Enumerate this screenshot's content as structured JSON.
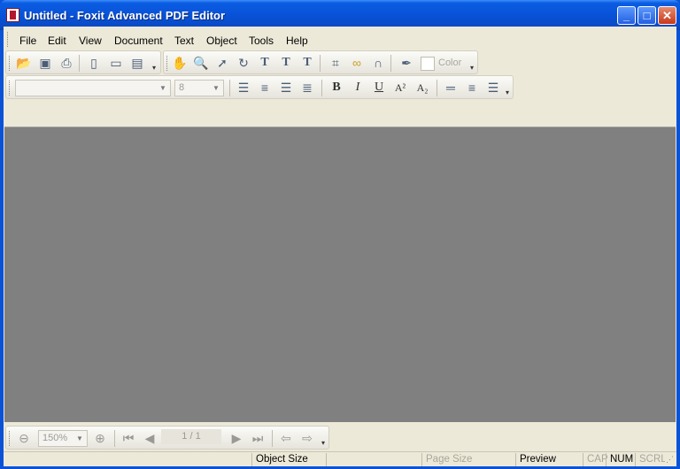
{
  "window": {
    "title": "Untitled - Foxit Advanced PDF Editor",
    "controls": {
      "minimize": "_",
      "maximize": "□",
      "close": "✕"
    }
  },
  "menu": [
    "File",
    "Edit",
    "View",
    "Document",
    "Text",
    "Object",
    "Tools",
    "Help"
  ],
  "toolbar1": {
    "icons": [
      "open-icon",
      "save-icon",
      "print-icon",
      "new-document-icon",
      "page-setup-icon",
      "page-properties-icon",
      "hand-tool-icon",
      "zoom-tool-icon",
      "select-arrow-icon",
      "rotate-icon",
      "text-tool-icon",
      "add-text-icon",
      "text-numbering-icon",
      "crop-icon",
      "link-icon",
      "path-tool-icon",
      "eyedropper-icon"
    ],
    "color_label": "Color"
  },
  "toolbar2": {
    "font_name": "",
    "font_size": "8",
    "buttons": [
      "align-left-icon",
      "align-center-icon",
      "align-right-icon",
      "justify-icon",
      "bold-icon",
      "italic-icon",
      "underline-icon",
      "superscript-icon",
      "subscript-icon",
      "line-spacing-1-icon",
      "line-spacing-2-icon",
      "line-spacing-3-icon"
    ],
    "bold": "B",
    "italic": "I",
    "underline": "U",
    "superscript": "A²",
    "subscript": "A₂"
  },
  "navbar": {
    "zoom_value": "150%",
    "page_indicator": "1 / 1"
  },
  "status": {
    "object_size": "Object Size",
    "page_size": "Page Size",
    "preview": "Preview",
    "cap": "CAP",
    "num": "NUM",
    "scrl": "SCRL"
  },
  "colors": {
    "title_bar": "#0A53D8",
    "document_background": "#808080",
    "chrome": "#ECE9D8"
  }
}
